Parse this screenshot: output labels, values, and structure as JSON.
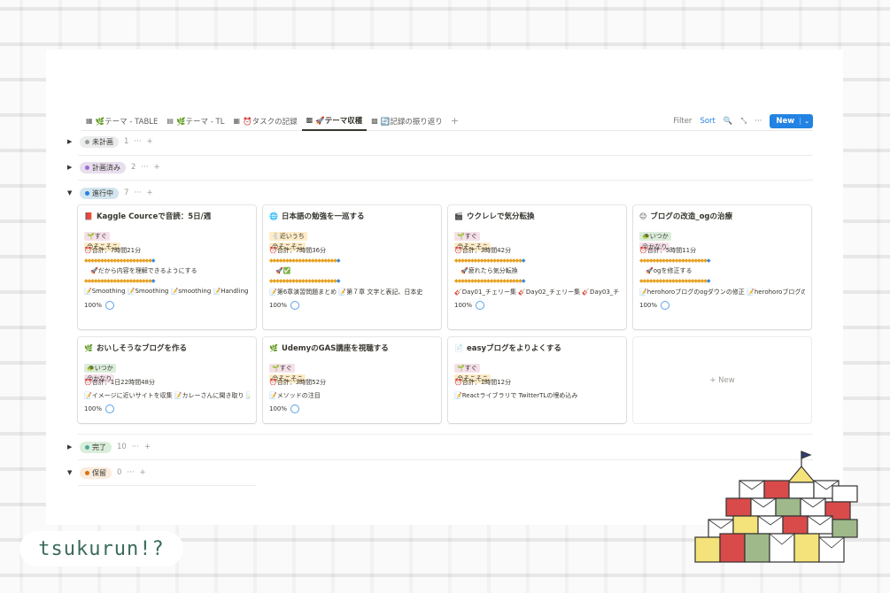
{
  "tabs": [
    {
      "icon": "▦",
      "label": "🌿テーマ - TABLE"
    },
    {
      "icon": "▤",
      "label": "🌿テーマ - TL"
    },
    {
      "icon": "▦",
      "label": "⏰タスクの記録"
    },
    {
      "icon": "▩",
      "label": "🚀テーマ収穫"
    },
    {
      "icon": "▩",
      "label": "🔄記録の振り返り"
    }
  ],
  "tab_plus": "+",
  "toolbar": {
    "filter": "Filter",
    "sort": "Sort",
    "search_icon": "🔍",
    "resize_icon": "⤡",
    "more_icon": "···",
    "new_label": "New",
    "new_chevron": "⌄"
  },
  "groups": [
    {
      "label": "未計画",
      "count": "1",
      "dot": "#9b9a97",
      "bg": "#ebeced",
      "collapsed": true
    },
    {
      "label": "計画済み",
      "count": "2",
      "dot": "#9a6dd7",
      "bg": "#e8deee",
      "collapsed": true
    },
    {
      "label": "進行中",
      "count": "7",
      "dot": "#2383e2",
      "bg": "#d3e5ef",
      "collapsed": false
    },
    {
      "label": "完了",
      "count": "10",
      "dot": "#4dab9a",
      "bg": "#dbeddb",
      "collapsed": true
    },
    {
      "label": "保留",
      "count": "0",
      "dot": "#d9730d",
      "bg": "#fbecdd",
      "collapsed": false
    }
  ],
  "group_more": "···",
  "group_plus": "+",
  "cards": [
    {
      "icon": "📕",
      "title": "Kaggle Courceで音読：5日/週",
      "tag1": "🌱すぐ",
      "tag1_bg": "#f5e0e9",
      "tag2": "😊そこそこ",
      "tag2_bg": "#fdecc8",
      "total": "⏰合計：7時間21分",
      "memo": "🚀だから内容を理解できるようにする",
      "relations": "📝Smoothing 📝Smoothing 📝smoothing 📝Handling",
      "percent": "100%"
    },
    {
      "icon": "🌐",
      "title": "日本語の勉強を一巡する",
      "tag1": "🐇近いうち",
      "tag1_bg": "#fdecc8",
      "tag2": "😊そこそこ",
      "tag2_bg": "#fdecc8",
      "total": "⏰合計：7時間36分",
      "memo": "🚀✅",
      "relations": "📝第6章演習問題まとめ 📝第７章 文字と表記、日本史",
      "percent": "100%"
    },
    {
      "icon": "🎬",
      "title": "ウクレレで気分転換",
      "tag1": "🌱すぐ",
      "tag1_bg": "#f5e0e9",
      "tag2": "😊そこそこ",
      "tag2_bg": "#fdecc8",
      "total": "⏰合計：3時間42分",
      "memo": "🚀疲れたら気分転換",
      "relations": "🎸Day01_チェリー集 🎸Day02_チェリー集 🎸Day03_チ",
      "percent": "100%"
    },
    {
      "icon": "😐",
      "title": "ブログの改造_ogの治療",
      "tag1": "🐢いつか",
      "tag1_bg": "#dbeddb",
      "tag2": "😝かなり",
      "tag2_bg": "#f5e0e9",
      "total": "⏰合計：5時間11分",
      "memo": "🚀ogを修正する",
      "relations": "📝herohoroブログのogダウンの修正 📝herohoroブログの",
      "percent": "100%"
    },
    {
      "icon": "🌿",
      "title": "おいしそうなブログを作る",
      "tag1": "🐢いつか",
      "tag1_bg": "#dbeddb",
      "tag2": "😝かなり",
      "tag2_bg": "#f5e0e9",
      "total": "⏰合計：1日22時間48分",
      "memo": "",
      "relations": "📝イメージに近いサイトを収集 📝カレーさんに聞き取り 📝",
      "percent": "100%"
    },
    {
      "icon": "🌿",
      "title": "UdemyのGAS講座を視聴する",
      "tag1": "🌱すぐ",
      "tag1_bg": "#f5e0e9",
      "tag2": "😊そこそこ",
      "tag2_bg": "#fdecc8",
      "total": "⏰合計：3時間52分",
      "memo": "",
      "relations": "📝メソッドの注目",
      "percent": "100%"
    },
    {
      "icon": "📄",
      "title": "easyブログをよりよくする",
      "tag1": "🌱すぐ",
      "tag1_bg": "#f5e0e9",
      "tag2": "😊そこそこ",
      "tag2_bg": "#fdecc8",
      "total": "⏰合計：1時間12分",
      "memo": "",
      "relations": "📝Reactライブラリで TwitterTLの埋め込み",
      "percent": "100%"
    }
  ],
  "new_card": "+ New",
  "brand": {
    "logo_text": "tsukurun!?"
  }
}
